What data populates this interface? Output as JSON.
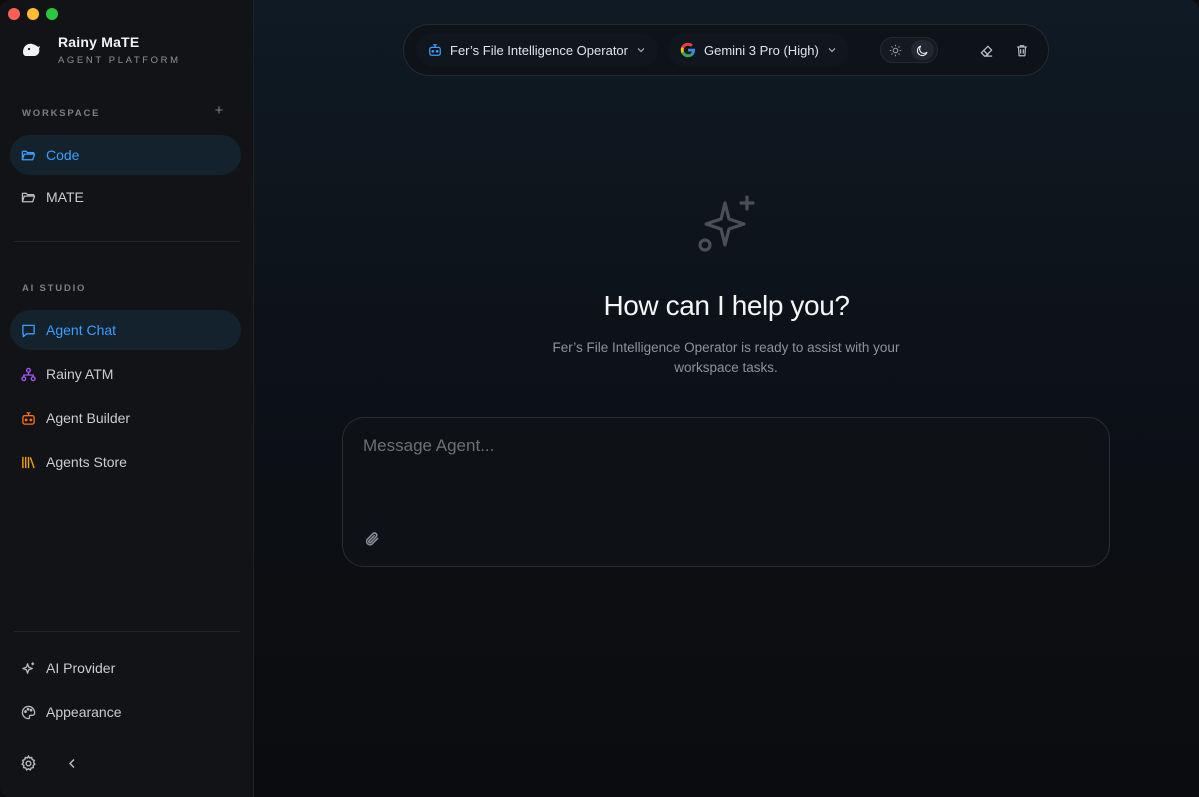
{
  "app": {
    "title": "Rainy MaTE",
    "subtitle": "AGENT PLATFORM"
  },
  "sidebar": {
    "workspace_label": "WORKSPACE",
    "workspace_items": [
      {
        "label": "Code",
        "active": true,
        "icon": "folder-open-icon"
      },
      {
        "label": "MATE",
        "active": false,
        "icon": "folder-icon"
      }
    ],
    "studio_label": "AI STUDIO",
    "studio_items": [
      {
        "label": "Agent Chat",
        "active": true,
        "icon": "chat-icon",
        "color": "#3b9eff"
      },
      {
        "label": "Rainy ATM",
        "active": false,
        "icon": "network-icon",
        "color": "#a855f7"
      },
      {
        "label": "Agent Builder",
        "active": false,
        "icon": "bot-icon",
        "color": "#f97316"
      },
      {
        "label": "Agents Store",
        "active": false,
        "icon": "library-icon",
        "color": "#f59e0b"
      }
    ],
    "footer_items": [
      {
        "label": "AI Provider",
        "icon": "sparkles-icon"
      },
      {
        "label": "Appearance",
        "icon": "palette-icon"
      }
    ]
  },
  "topbar": {
    "agent_name": "Fer’s File Intelligence Operator",
    "model_name": "Gemini 3 Pro (High)",
    "theme": "dark"
  },
  "hero": {
    "title": "How can I help you?",
    "subtitle": "Fer’s File Intelligence Operator is ready to assist with your workspace tasks."
  },
  "composer": {
    "placeholder": "Message Agent..."
  },
  "colors": {
    "accent": "#3b9eff",
    "active_bg": "#14222e"
  }
}
